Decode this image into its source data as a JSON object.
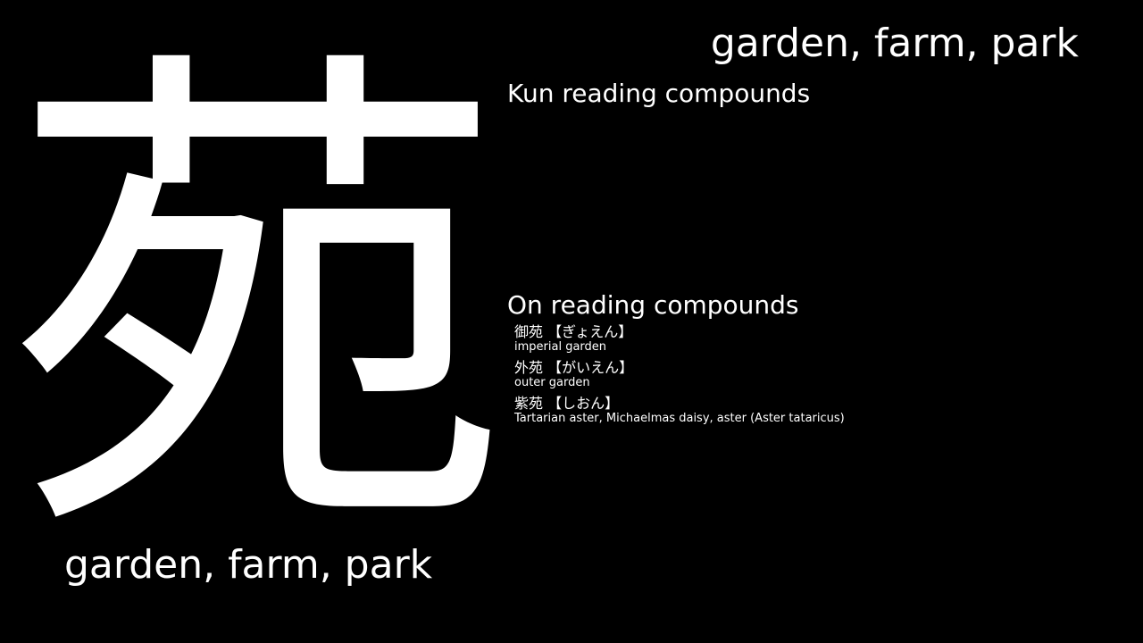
{
  "kanji": "苑",
  "meaning_top": "garden, farm, park",
  "meaning_bottom": "garden, farm, park",
  "kun_heading": "Kun reading compounds",
  "on_heading": "On reading compounds",
  "on_compounds": [
    {
      "word": "御苑 【ぎょえん】",
      "gloss": "imperial garden"
    },
    {
      "word": "外苑 【がいえん】",
      "gloss": "outer garden"
    },
    {
      "word": "紫苑 【しおん】",
      "gloss": "Tartarian aster, Michaelmas daisy, aster (Aster tataricus)"
    }
  ],
  "colors": {
    "background": "#000000",
    "text": "#ffffff"
  }
}
